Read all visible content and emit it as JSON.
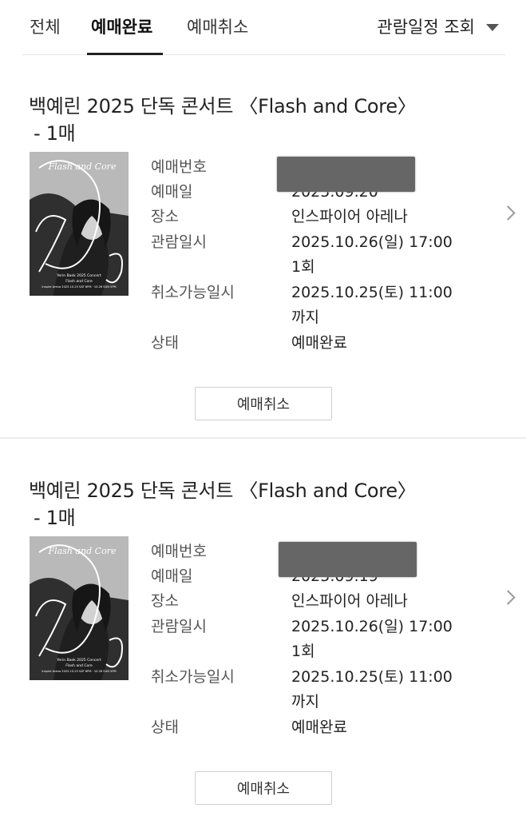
{
  "tabs": {
    "all": "전체",
    "completed": "예매완료",
    "cancelled": "예매취소"
  },
  "filter": {
    "label": "관람일정 조회"
  },
  "field_labels": {
    "booking_no": "예매번호",
    "booking_date": "예매일",
    "venue": "장소",
    "show_datetime": "관람일시",
    "cancel_deadline": "취소가능일시",
    "status": "상태"
  },
  "bookings": [
    {
      "title_line1": "백예린 2025 단독 콘서트 〈Flash and Core〉",
      "title_line2": "- 1매",
      "booking_date": "2025.09.20",
      "venue": "인스파이어 아레나",
      "show_datetime": "2025.10.26(일) 17:00 1회",
      "cancel_deadline": "2025.10.25(토) 11:00 까지",
      "status": "예매완료",
      "cancel_button": "예매취소",
      "poster": {
        "title": "Flash and Core",
        "caption_1": "Yerin Baek 2025 Concert",
        "caption_2": "Flash and Core",
        "caption_3": "Inspire Arena 2025.10.25 SAT 6PM · 10.26 SUN 5PM"
      }
    },
    {
      "title_line1": "백예린 2025 단독 콘서트 〈Flash and Core〉",
      "title_line2": "- 1매",
      "booking_date": "2025.09.19",
      "venue": "인스파이어 아레나",
      "show_datetime": "2025.10.26(일) 17:00 1회",
      "cancel_deadline": "2025.10.25(토) 11:00 까지",
      "status": "예매완료",
      "cancel_button": "예매취소",
      "poster": {
        "title": "Flash and Core",
        "caption_1": "Yerin Baek 2025 Concert",
        "caption_2": "Flash and Core",
        "caption_3": "Inspire Arena 2025.10.25 SAT 6PM · 10.26 SUN 5PM"
      }
    }
  ],
  "colors": {
    "active_tab": "#111111",
    "masked_block": "#666666",
    "poster_bg": "#3c3c3c"
  }
}
